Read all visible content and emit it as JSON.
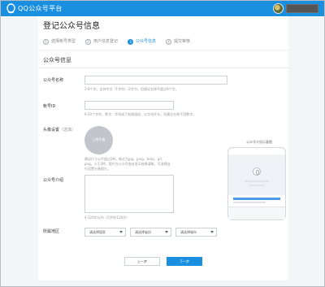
{
  "header": {
    "brand": "QQ公众号平台",
    "logo_icon": "qq-logo-icon",
    "avatar_icon": "user-avatar-icon",
    "bg_color": "#1a8fe0"
  },
  "page": {
    "title": "登记公众号信息",
    "steps": [
      {
        "num": "1",
        "label": "选择帐号类型",
        "active": false
      },
      {
        "num": "2",
        "label": "用户信息登记",
        "active": false
      },
      {
        "num": "3",
        "label": "公众号信息",
        "active": true
      },
      {
        "num": "4",
        "label": "提交审核",
        "active": false
      }
    ]
  },
  "form": {
    "section_title": "公众号信息",
    "name": {
      "label": "公众号名称",
      "value": "",
      "hint": "2-8个字，支持中文（1字符）/2字节，但建议名称不超过8个字。"
    },
    "qqid": {
      "label": "帐号ID",
      "value": "",
      "hint": "6-20个字符，数字、字母或下划线组成，以字母开头，但建议名称不用数字。"
    },
    "avatar": {
      "label": "头像设置",
      "optional": "（选填）",
      "upload_label": "上传头像",
      "hint": "建议尺寸以不超过2M，格式为jpg、jpeg、bmp、gif、png，小于2M，图片在公众号各处显示效果清晰，可选择自行设置头像图片。"
    },
    "intro": {
      "label": "公众号介绍",
      "value": "",
      "hint": "4-120字以内（2字符/120字）"
    },
    "region": {
      "label": "所属地区",
      "selects": [
        "请选择国家",
        "请选择省份",
        "请选择城市"
      ]
    },
    "preview": {
      "title": "公众号介绍示意图"
    },
    "buttons": {
      "prev": "上一步",
      "next": "下一步"
    }
  }
}
